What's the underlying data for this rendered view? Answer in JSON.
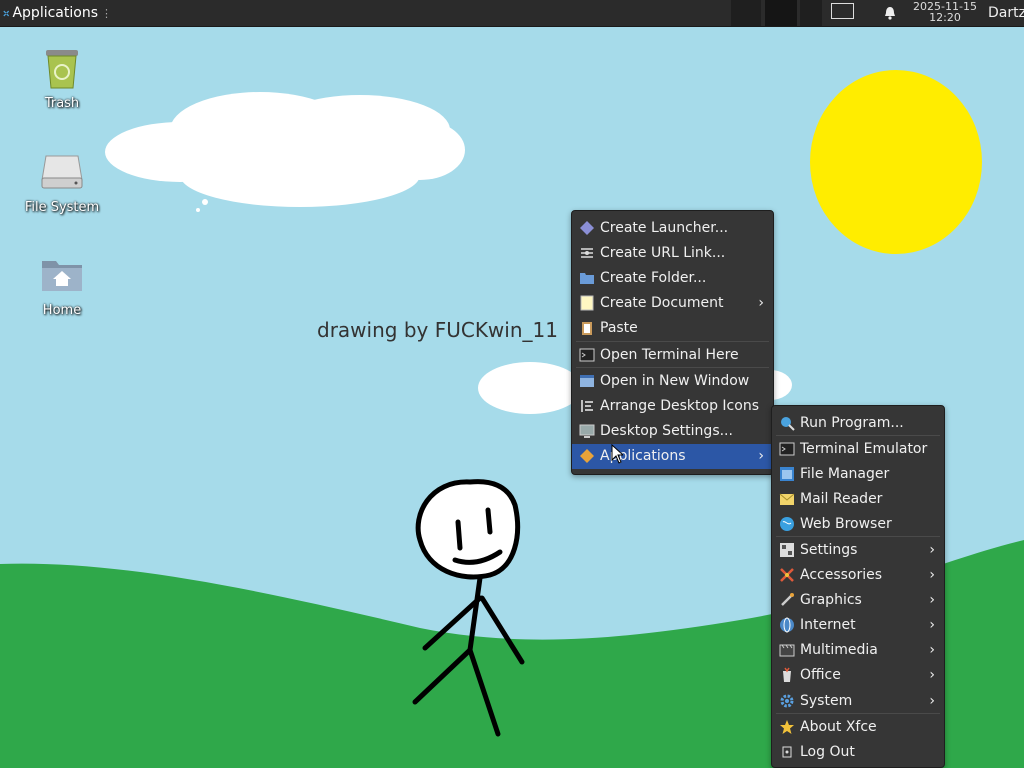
{
  "panel": {
    "applications_label": "Applications",
    "clock_date": "2025-11-15",
    "clock_time": "12:20",
    "user": "Dartz"
  },
  "desktop": {
    "icons": [
      {
        "label": "Trash",
        "icon": "trash-icon"
      },
      {
        "label": "File System",
        "icon": "drive-icon"
      },
      {
        "label": "Home",
        "icon": "home-folder-icon"
      }
    ],
    "caption": "drawing by FUCKwin_11"
  },
  "context_menu": {
    "items": [
      {
        "label": "Create Launcher...",
        "icon": "launcher-icon"
      },
      {
        "label": "Create URL Link...",
        "icon": "url-link-icon"
      },
      {
        "label": "Create Folder...",
        "icon": "folder-icon"
      },
      {
        "label": "Create Document",
        "icon": "document-icon",
        "submenu": true
      },
      {
        "label": "Paste",
        "icon": "paste-icon"
      },
      {
        "label": "Open Terminal Here",
        "icon": "terminal-icon"
      },
      {
        "label": "Open in New Window",
        "icon": "window-icon"
      },
      {
        "label": "Arrange Desktop Icons",
        "icon": "arrange-icon"
      },
      {
        "label": "Desktop Settings...",
        "icon": "desktop-settings-icon"
      },
      {
        "label": "Applications",
        "icon": "applications-icon",
        "submenu": true,
        "active": true
      }
    ]
  },
  "apps_menu": {
    "items": [
      {
        "label": "Run Program...",
        "icon": "run-icon"
      },
      {
        "label": "Terminal Emulator",
        "icon": "terminal-icon"
      },
      {
        "label": "File Manager",
        "icon": "file-manager-icon"
      },
      {
        "label": "Mail Reader",
        "icon": "mail-icon"
      },
      {
        "label": "Web Browser",
        "icon": "globe-icon"
      },
      {
        "label": "Settings",
        "icon": "settings-icon",
        "submenu": true
      },
      {
        "label": "Accessories",
        "icon": "accessories-icon",
        "submenu": true
      },
      {
        "label": "Graphics",
        "icon": "graphics-icon",
        "submenu": true
      },
      {
        "label": "Internet",
        "icon": "internet-icon",
        "submenu": true
      },
      {
        "label": "Multimedia",
        "icon": "multimedia-icon",
        "submenu": true
      },
      {
        "label": "Office",
        "icon": "office-icon",
        "submenu": true
      },
      {
        "label": "System",
        "icon": "gear-icon",
        "submenu": true
      },
      {
        "label": "About Xfce",
        "icon": "star-icon"
      },
      {
        "label": "Log Out",
        "icon": "logout-icon"
      }
    ]
  },
  "colors": {
    "panel_bg": "#2b2b2b",
    "menu_bg": "#363636",
    "menu_highlight": "#2c57a6",
    "sky": "#a6dbea",
    "grass": "#2fa84a",
    "sun": "#ffed00"
  }
}
